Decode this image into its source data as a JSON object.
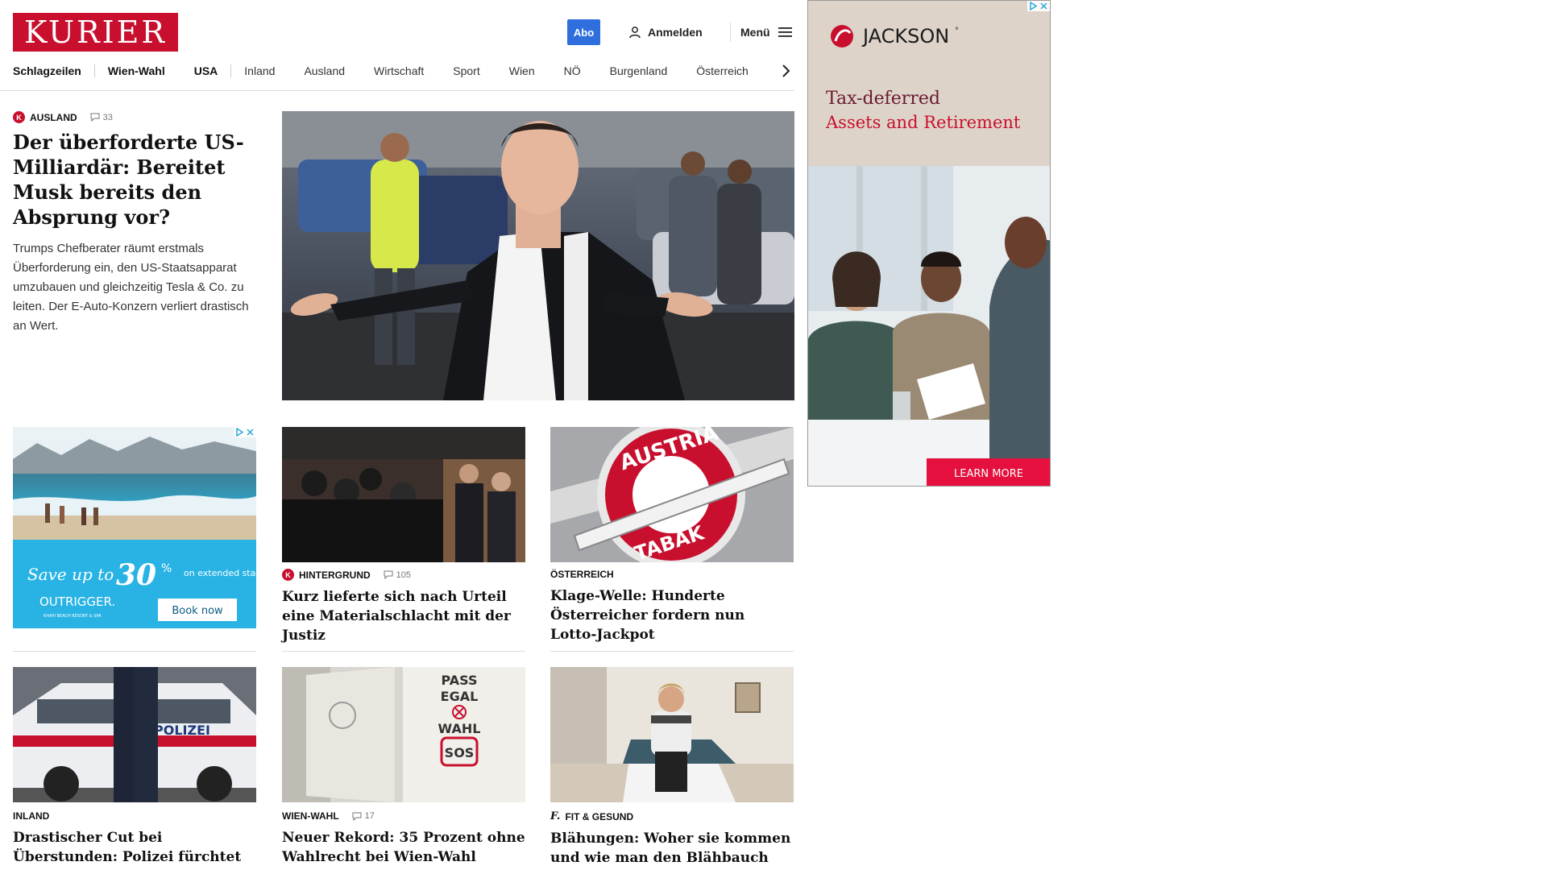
{
  "header": {
    "logo": "KURIER",
    "abo_label": "Abo",
    "login_label": "Anmelden",
    "menu_label": "Menü"
  },
  "nav": {
    "items": [
      "Schlagzeilen",
      "Wien-Wahl",
      "USA",
      "Inland",
      "Ausland",
      "Wirtschaft",
      "Sport",
      "Wien",
      "NÖ",
      "Burgenland",
      "Österreich"
    ]
  },
  "lead": {
    "kicker": "AUSLAND",
    "comments": "33",
    "headline": "Der überforderte US-Milliardär: Bereitet Musk bereits den Absprung vor?",
    "summary": "Trumps Chefberater räumt erstmals Überforderung ein, den US-Staatsapparat umzubauen und gleichzeitig Tesla & Co. zu leiten. Der E-Auto-Konzern verliert drastisch an Wert."
  },
  "teasers": [
    {
      "kicker": "HINTERGRUND",
      "comments": "105",
      "headline": "Kurz lieferte sich nach Urteil eine Materialschlacht mit der Justiz"
    },
    {
      "kicker": "ÖSTERREICH",
      "headline": "Klage-Welle: Hunderte Österreicher fordern nun Lotto-Jackpot"
    },
    {
      "kicker": "INLAND",
      "headline": "Drastischer Cut bei Überstunden: Polizei fürchtet große Sparwelle"
    },
    {
      "kicker": "WIEN-WAHL",
      "comments": "17",
      "headline": "Neuer Rekord: 35 Prozent ohne Wahlrecht bei Wien-Wahl"
    },
    {
      "kicker": "FIT & GESUND",
      "headline": "Blähungen: Woher sie kommen und wie man den Blähbauch los wird"
    }
  ],
  "images": {
    "tabak_ring_top": "AUSTRIA",
    "tabak_ring_bottom": "TABAK",
    "police_label": "POLIZEI",
    "poster_lines": [
      "PASS",
      "EGAL",
      "WAHL",
      "SOS"
    ]
  },
  "ad_small": {
    "headline_pre": "Save up to",
    "percent": "30",
    "percent_sign": "%",
    "headline_post": "on extended stays",
    "brand": "OUTRIGGER.",
    "brand_sub": "KHAPI BEACH RESORT & SPA",
    "cta": "Book now"
  },
  "ad_big": {
    "brand": "JACKSON",
    "brand_mark": "°",
    "line1": "Tax-deferred",
    "line2": "Assets and Retirement",
    "cta": "LEARN MORE"
  },
  "colors": {
    "brand_red": "#c8102e",
    "abo_blue": "#2f6fdd",
    "jackson_red": "#c8102e"
  }
}
